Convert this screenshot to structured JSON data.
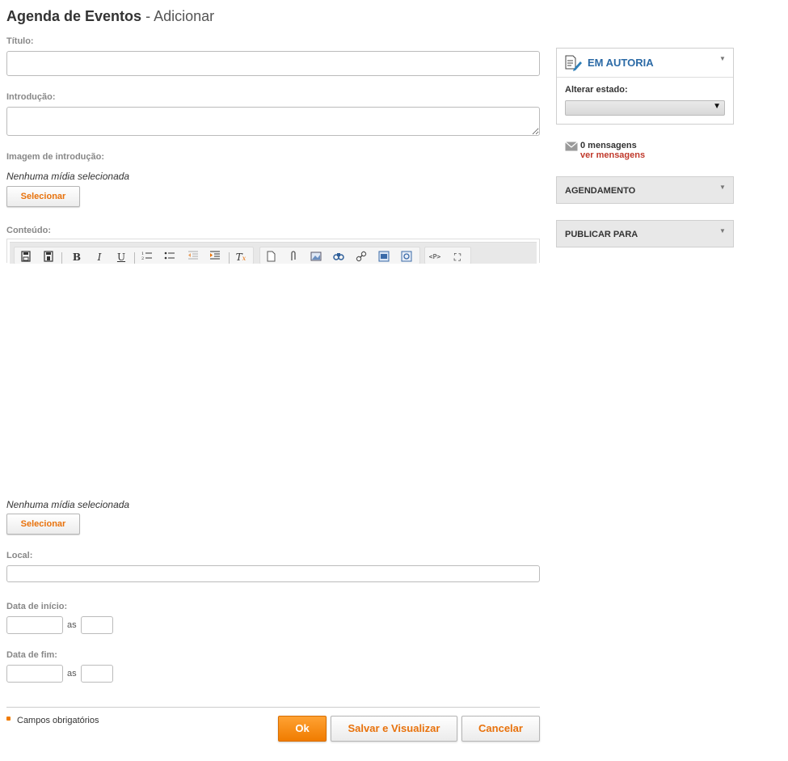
{
  "page": {
    "title": "Agenda de Eventos",
    "title_suffix": "- Adicionar"
  },
  "form": {
    "titulo_label": "Título:",
    "titulo_value": "",
    "introducao_label": "Introdução:",
    "introducao_value": "",
    "imagem_label": "Imagem de introdução:",
    "imagem_status": "Nenhuma mídia selecionada",
    "select_label": "Selecionar",
    "conteudo_label": "Conteúdo:",
    "media_status_2": "Nenhuma mídia selecionada",
    "select_label_2": "Selecionar",
    "local_label": "Local:",
    "local_value": "",
    "data_inicio_label": "Data de início:",
    "data_fim_label": "Data de fim:",
    "as_label": "as",
    "required_note": "Campos obrigatórios"
  },
  "editor_toolbar": {
    "icons": [
      "save-icon",
      "save-as-icon",
      "bold-icon",
      "italic-icon",
      "underline-icon",
      "ordered-list-icon",
      "unordered-list-icon",
      "outdent-icon",
      "indent-icon",
      "clear-format-icon",
      "document-icon",
      "attachment-icon",
      "image-icon",
      "find-icon",
      "link-icon",
      "media-icon",
      "preview-icon",
      "source-code-icon",
      "fullscreen-icon"
    ],
    "bold": "B",
    "italic": "I",
    "underline": "U",
    "clear_format": "T",
    "source_code": "<P>",
    "fullscreen": "⛶"
  },
  "sidebar": {
    "authoring": {
      "title": "EM AUTORIA",
      "change_state_label": "Alterar estado:",
      "state_value": ""
    },
    "messages": {
      "count": "0 mensagens",
      "link": "ver mensagens"
    },
    "scheduling": {
      "title": "AGENDAMENTO"
    },
    "publish": {
      "title": "PUBLICAR PARA"
    }
  },
  "actions": {
    "ok": "Ok",
    "save_preview": "Salvar e Visualizar",
    "cancel": "Cancelar"
  },
  "colors": {
    "accent": "#f07c00",
    "link_red": "#c0392b",
    "panel_title_blue": "#2b6aa6"
  }
}
